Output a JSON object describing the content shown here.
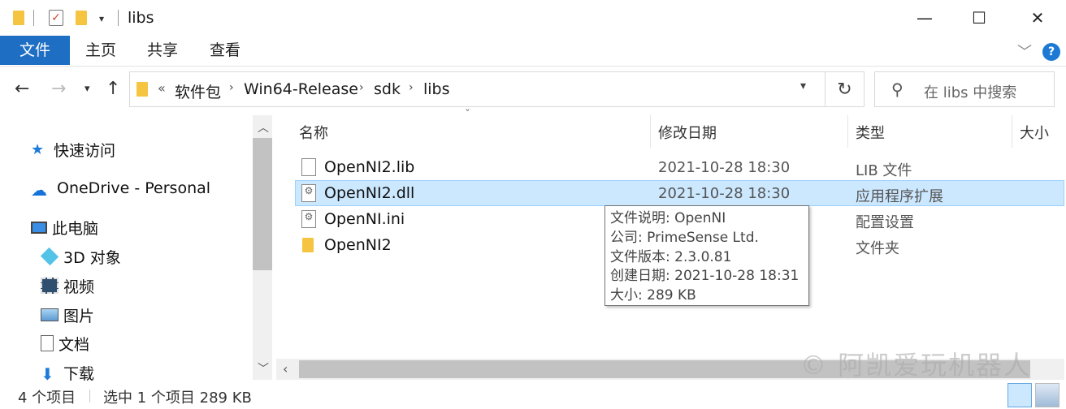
{
  "window": {
    "title": "libs",
    "close_glyph": "✕",
    "maximize_glyph": "☐",
    "minimize_glyph": "—"
  },
  "ribbon": {
    "tabs": [
      "文件",
      "主页",
      "共享",
      "查看"
    ]
  },
  "address": {
    "overflow": "«",
    "breadcrumbs": [
      "软件包",
      "Win64-Release",
      "sdk",
      "libs"
    ],
    "separator": "›"
  },
  "search": {
    "placeholder": "在 libs 中搜索"
  },
  "nav_pane": {
    "items": [
      {
        "label": "快速访问",
        "icon": "star-icon"
      },
      {
        "label": "OneDrive - Personal",
        "icon": "cloud-icon"
      },
      {
        "label": "此电脑",
        "icon": "computer-icon"
      },
      {
        "label": "3D 对象",
        "icon": "cube-icon"
      },
      {
        "label": "视频",
        "icon": "video-icon"
      },
      {
        "label": "图片",
        "icon": "pictures-icon"
      },
      {
        "label": "文档",
        "icon": "document-icon"
      },
      {
        "label": "下载",
        "icon": "download-icon"
      }
    ]
  },
  "columns": {
    "name": "名称",
    "date": "修改日期",
    "type": "类型",
    "size": "大小"
  },
  "files": [
    {
      "name": "OpenNI2.lib",
      "date": "2021-10-28 18:30",
      "type": "LIB 文件",
      "icon": "file-icon"
    },
    {
      "name": "OpenNI2.dll",
      "date": "2021-10-28 18:30",
      "type": "应用程序扩展",
      "icon": "dll-icon",
      "selected": true
    },
    {
      "name": "OpenNI.ini",
      "date": "",
      "type": "配置设置",
      "icon": "settings-file-icon"
    },
    {
      "name": "OpenNI2",
      "date": "",
      "type": "文件夹",
      "icon": "folder-icon"
    }
  ],
  "tooltip": {
    "description": "文件说明: OpenNI",
    "company": "公司: PrimeSense Ltd.",
    "version": "文件版本: 2.3.0.81",
    "created": "创建日期: 2021-10-28 18:31",
    "size": "大小: 289 KB"
  },
  "status": {
    "count": "4 个项目",
    "selection": "选中 1 个项目 289 KB"
  },
  "watermark": "© 阿凯爱玩机器人",
  "colors": {
    "accent": "#1e6fc4",
    "selection": "#cce8ff",
    "selection_border": "#99d1ff"
  }
}
